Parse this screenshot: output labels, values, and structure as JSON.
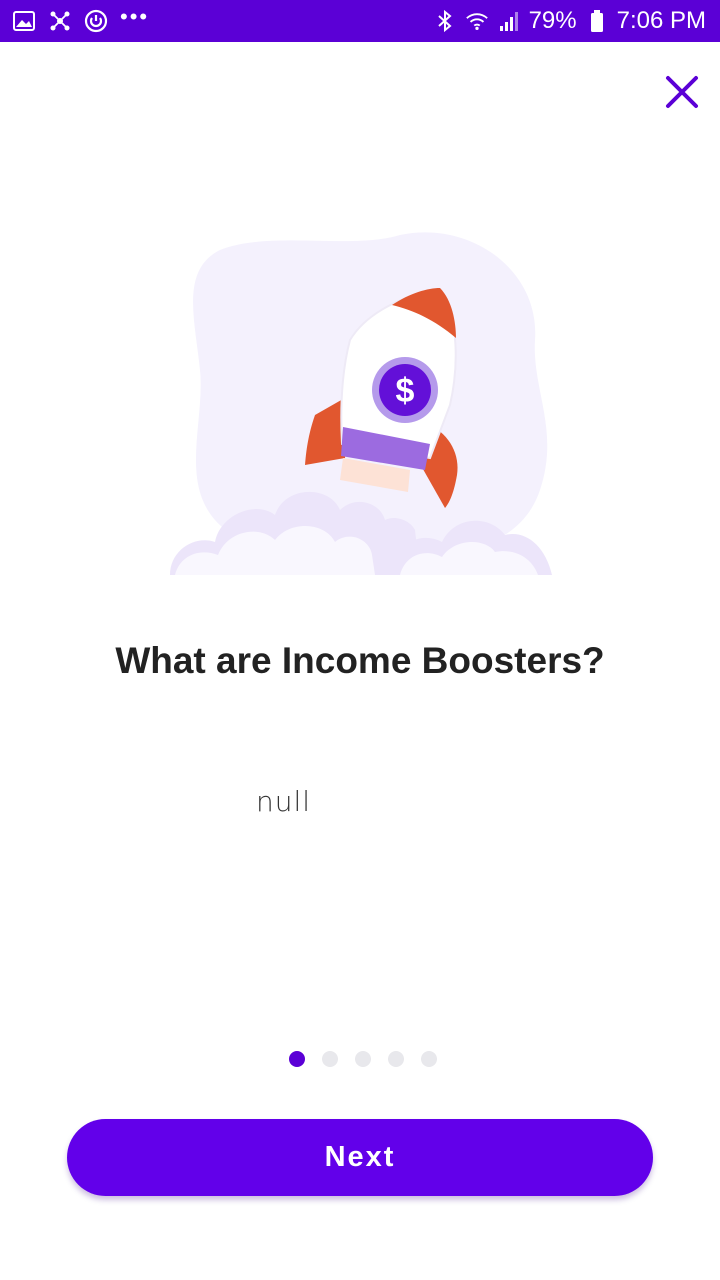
{
  "status_bar": {
    "battery": "79%",
    "time": "7:06 PM",
    "left_icons": [
      "image-icon",
      "network-icon",
      "sync-icon",
      "more-dots-icon"
    ],
    "right_icons": [
      "bluetooth-icon",
      "wifi-icon",
      "signal-icon",
      "battery-icon"
    ],
    "more_dots": "•••"
  },
  "header": {
    "close_icon": "close-icon"
  },
  "content": {
    "title": "What are Income Boosters?",
    "body": "null"
  },
  "pager": {
    "count": 5,
    "active_index": 0
  },
  "actions": {
    "next_label": "Next"
  },
  "colors": {
    "brand": "#5b00d6",
    "button": "#6200ea",
    "rocket_orange": "#e1572f",
    "rocket_purple": "#9c6be0",
    "cloud": "#f3effc"
  }
}
